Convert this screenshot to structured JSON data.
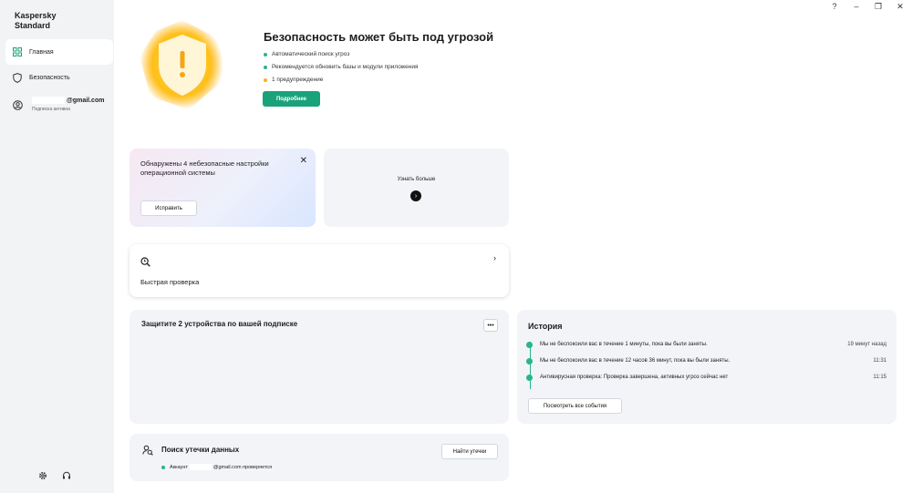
{
  "app": {
    "brand_line1": "Kaspersky",
    "brand_line2": "Standard"
  },
  "window_controls": {
    "help": "?",
    "minimize": "–",
    "restore": "❐",
    "close": "✕"
  },
  "sidebar": {
    "items": [
      {
        "label": "Главная",
        "icon": "home-grid-icon",
        "active": true
      },
      {
        "label": "Безопасность",
        "icon": "shield-icon",
        "active": false
      }
    ],
    "account": {
      "email_suffix": "@gmail.com",
      "subscription": "Подписка активна",
      "icon": "user-avatar-icon"
    },
    "bottom_icons": [
      "settings-gear-icon",
      "support-headset-icon"
    ]
  },
  "hero": {
    "title": "Безопасность может быть под угрозой",
    "items": [
      {
        "text": "Автоматический поиск угроз",
        "color": "#29b48a"
      },
      {
        "text": "Рекомендуется обновить базы и модули приложения",
        "color": "#29b48a"
      },
      {
        "text": "1 предупреждение",
        "color": "#f2b51d"
      }
    ],
    "button_label": "Подробнее",
    "shield_colors": {
      "inner": "#fff6d8",
      "glow": "#ffc21c",
      "mark": "#f3a712"
    }
  },
  "warning_card": {
    "text": "Обнаружены 4 небезопасные настройки операционной системы",
    "button_label": "Исправить",
    "close": "✕"
  },
  "learn_card": {
    "label": "Узнать больше",
    "arrow": "›"
  },
  "scan_card": {
    "label": "Быстрая проверка",
    "chevron": "›"
  },
  "devices_card": {
    "title": "Защитите 2 устройства по вашей подписке",
    "more": "•••"
  },
  "history": {
    "title": "История",
    "events": [
      {
        "text": "Мы не беспокоили вас в течение 1 минуты, пока вы были заняты.",
        "time": "19 минут назад"
      },
      {
        "text": "Мы не беспокоили вас в течение 12 часов 36 минут, пока вы были заняты.",
        "time": "11:31"
      },
      {
        "text": "Антивирусная проверка: Проверка завершена, активных угроз сейчас нет",
        "time": "11:15"
      }
    ],
    "button_label": "Посмотреть все события"
  },
  "leak_card": {
    "title": "Поиск утечки данных",
    "button_label": "Найти утечки",
    "status_prefix": "Аккаунт",
    "status_suffix": "@gmail.com проверяется"
  }
}
